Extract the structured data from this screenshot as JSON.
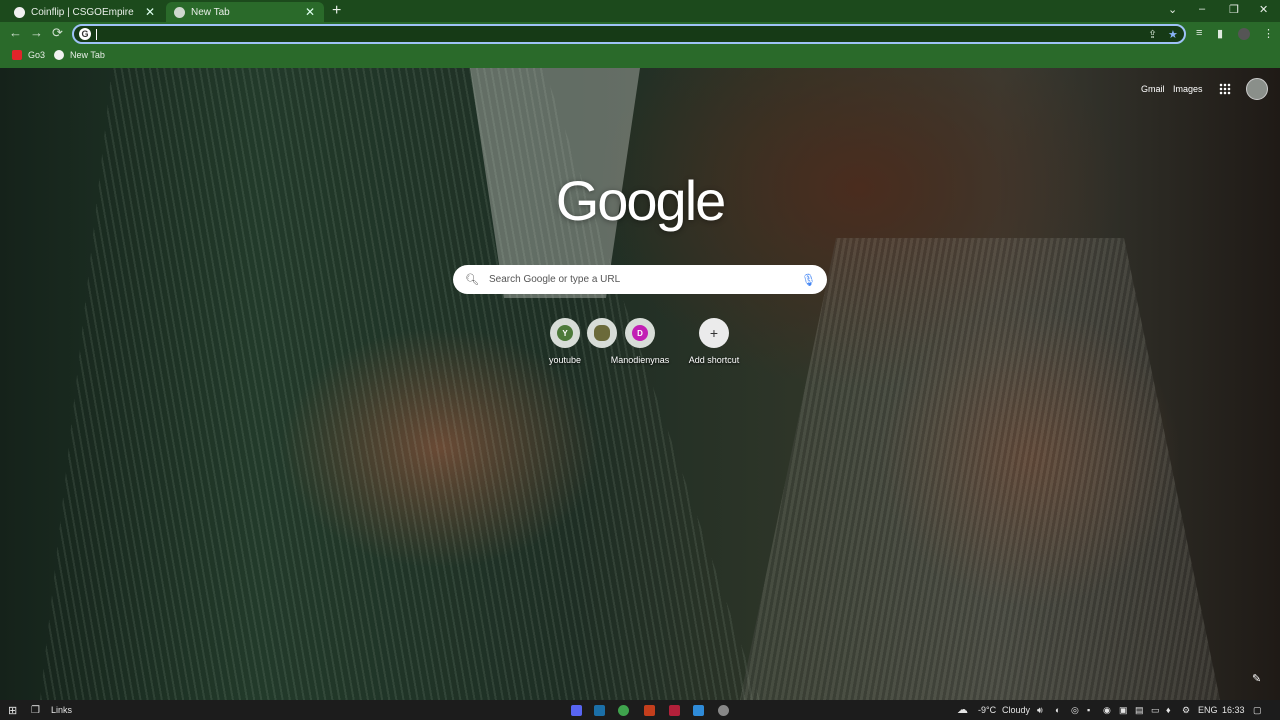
{
  "tabs": [
    {
      "title": "Coinflip | CSGOEmpire",
      "favicon_color": "#f0f0f0",
      "active": false
    },
    {
      "title": "New Tab",
      "favicon_color": "#cfd8cf",
      "active": true
    }
  ],
  "tab_close": "✕",
  "new_tab_symbol": "+",
  "window_controls": {
    "dropdown": "⌄",
    "minimize": "–",
    "restore": "❐",
    "close": "✕"
  },
  "toolbar": {
    "back": "←",
    "forward": "→",
    "reload": "⟳",
    "address_value": "",
    "share": "⇪",
    "bookmark_star": "★",
    "icons": [
      "reading-list-icon",
      "side-panel-icon",
      "profile-icon",
      "menu-icon"
    ]
  },
  "bookmarks": [
    {
      "label": "Go3",
      "icon_color": "#e0242a"
    },
    {
      "label": "New Tab",
      "icon_color": "#f1f1f1"
    }
  ],
  "ntp": {
    "top_links": [
      "Gmail",
      "Images"
    ],
    "logo": "Google",
    "search_placeholder": "Search Google or type a URL",
    "shortcuts": [
      {
        "label": "youtube",
        "letter": "Y",
        "color": "#4d7a3a"
      },
      {
        "label": "",
        "letter": "",
        "color": "#6b6a3a"
      },
      {
        "label": "Manodienynas",
        "letter": "D",
        "color": "#c21fb4"
      },
      {
        "label": "Add shortcut",
        "letter": "+",
        "color": "#ffffff"
      }
    ]
  },
  "taskbar": {
    "search_label": "Links",
    "weather": {
      "temp": "-9°C",
      "condition": "Cloudy"
    },
    "language": "ENG",
    "time": "16:33",
    "pinned_apps": [
      {
        "name": "discord",
        "color": "#5865f2"
      },
      {
        "name": "steam",
        "color": "#1b6fa8"
      },
      {
        "name": "chrome",
        "color": "#3fa34d"
      },
      {
        "name": "powerpoint",
        "color": "#c43e1c"
      },
      {
        "name": "other-app",
        "color": "#b3203a"
      },
      {
        "name": "snipping-tool",
        "color": "#2f8bd8"
      },
      {
        "name": "settings",
        "color": "#888888"
      }
    ]
  }
}
